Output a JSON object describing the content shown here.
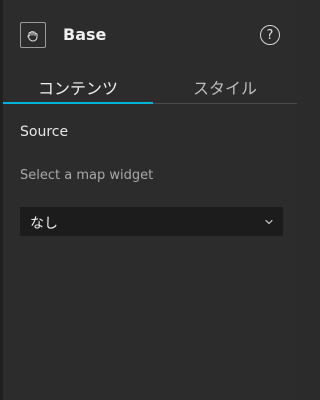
{
  "header": {
    "title": "Base",
    "widget_icon": "widget-hand-icon",
    "help_icon": "help-circle-icon",
    "help_glyph": "?"
  },
  "tabs": [
    {
      "label": "コンテンツ",
      "active": true
    },
    {
      "label": "スタイル",
      "active": false
    }
  ],
  "source": {
    "title": "Source",
    "hint": "Select a map widget",
    "select_value": "なし"
  },
  "colors": {
    "background": "#2c2c2c",
    "accent": "#00b4d8",
    "select_bg": "#1c1c1c"
  }
}
